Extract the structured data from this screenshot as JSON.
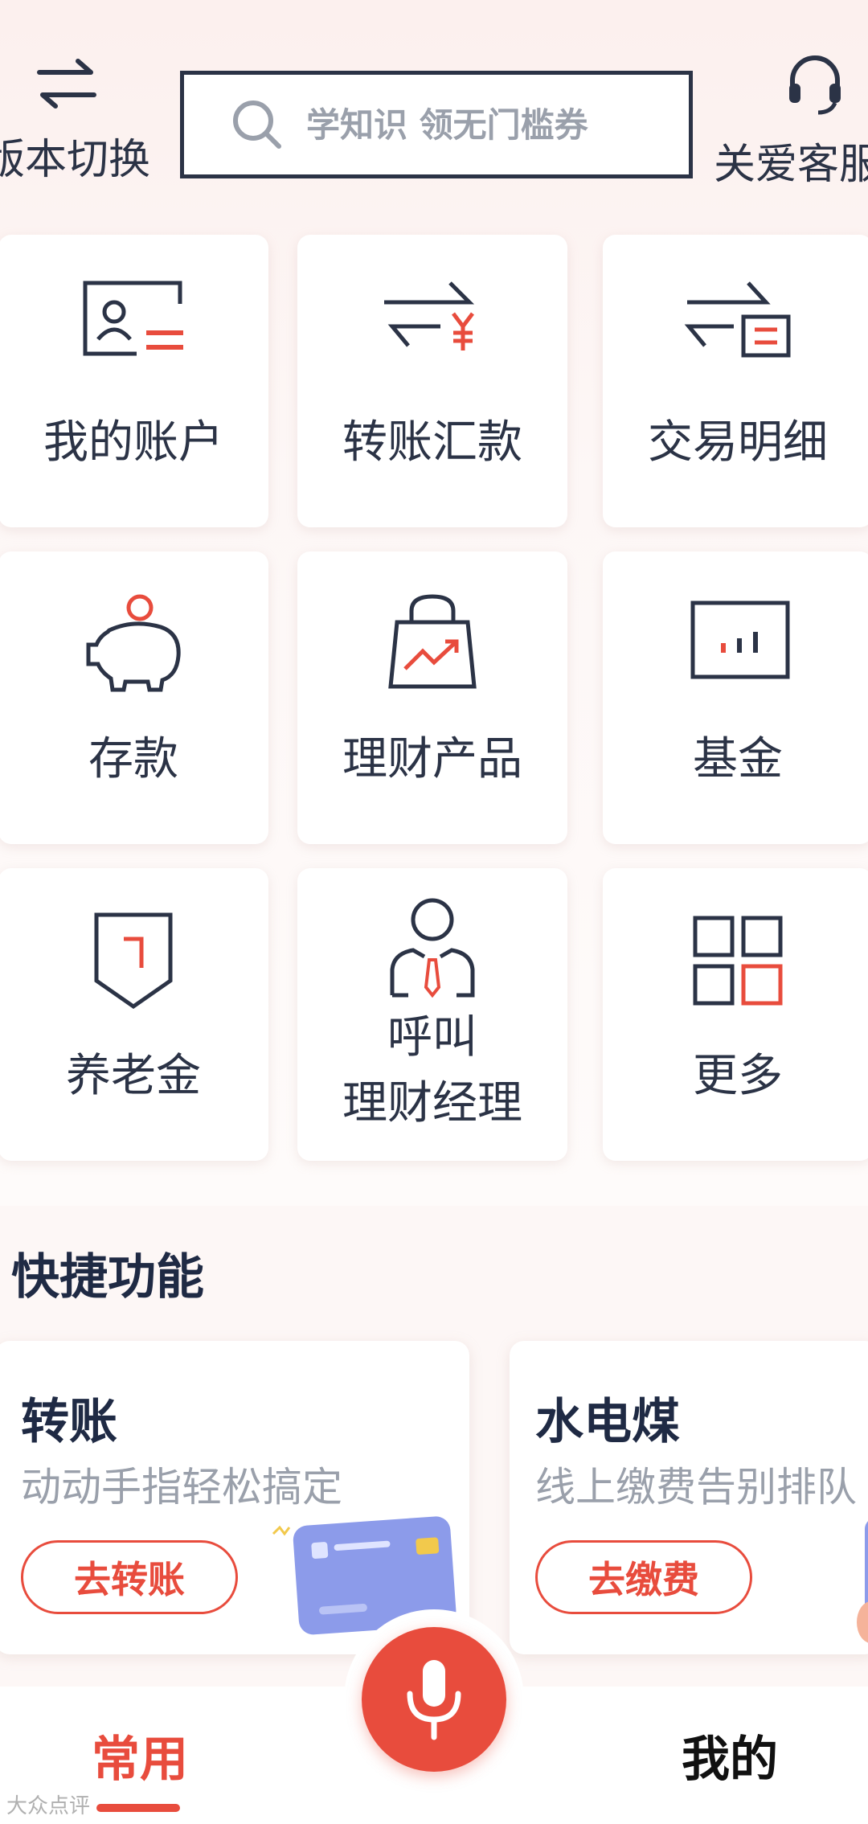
{
  "header": {
    "version_switch_label": "版本切换",
    "search_placeholder": "学知识 领无门槛券",
    "customer_service_label": "关爱客服"
  },
  "grid": {
    "items": [
      {
        "label": "我的账户",
        "icon": "account-card-icon"
      },
      {
        "label": "转账汇款",
        "icon": "transfer-yen-icon"
      },
      {
        "label": "交易明细",
        "icon": "transaction-detail-icon"
      },
      {
        "label": "存款",
        "icon": "piggy-bank-icon"
      },
      {
        "label": "理财产品",
        "icon": "shopping-bag-chart-icon"
      },
      {
        "label": "基金",
        "icon": "fund-chart-icon"
      },
      {
        "label": "养老金",
        "icon": "pension-shield-icon"
      },
      {
        "label_line1": "呼叫",
        "label_line2": "理财经理",
        "icon": "manager-person-icon"
      },
      {
        "label": "更多",
        "icon": "more-grid-icon"
      }
    ]
  },
  "quick": {
    "title": "快捷功能",
    "cards": [
      {
        "title": "转账",
        "subtitle": "动动手指轻松搞定",
        "button": "去转账"
      },
      {
        "title": "水电煤",
        "subtitle": "线上缴费告别排队",
        "button": "去缴费"
      }
    ]
  },
  "nav": {
    "left": "常用",
    "right": "我的",
    "center_icon": "microphone-icon"
  },
  "watermark": "大众点评",
  "colors": {
    "accent": "#e84c3d",
    "ink": "#2b3346",
    "muted": "#9aa0ab"
  }
}
